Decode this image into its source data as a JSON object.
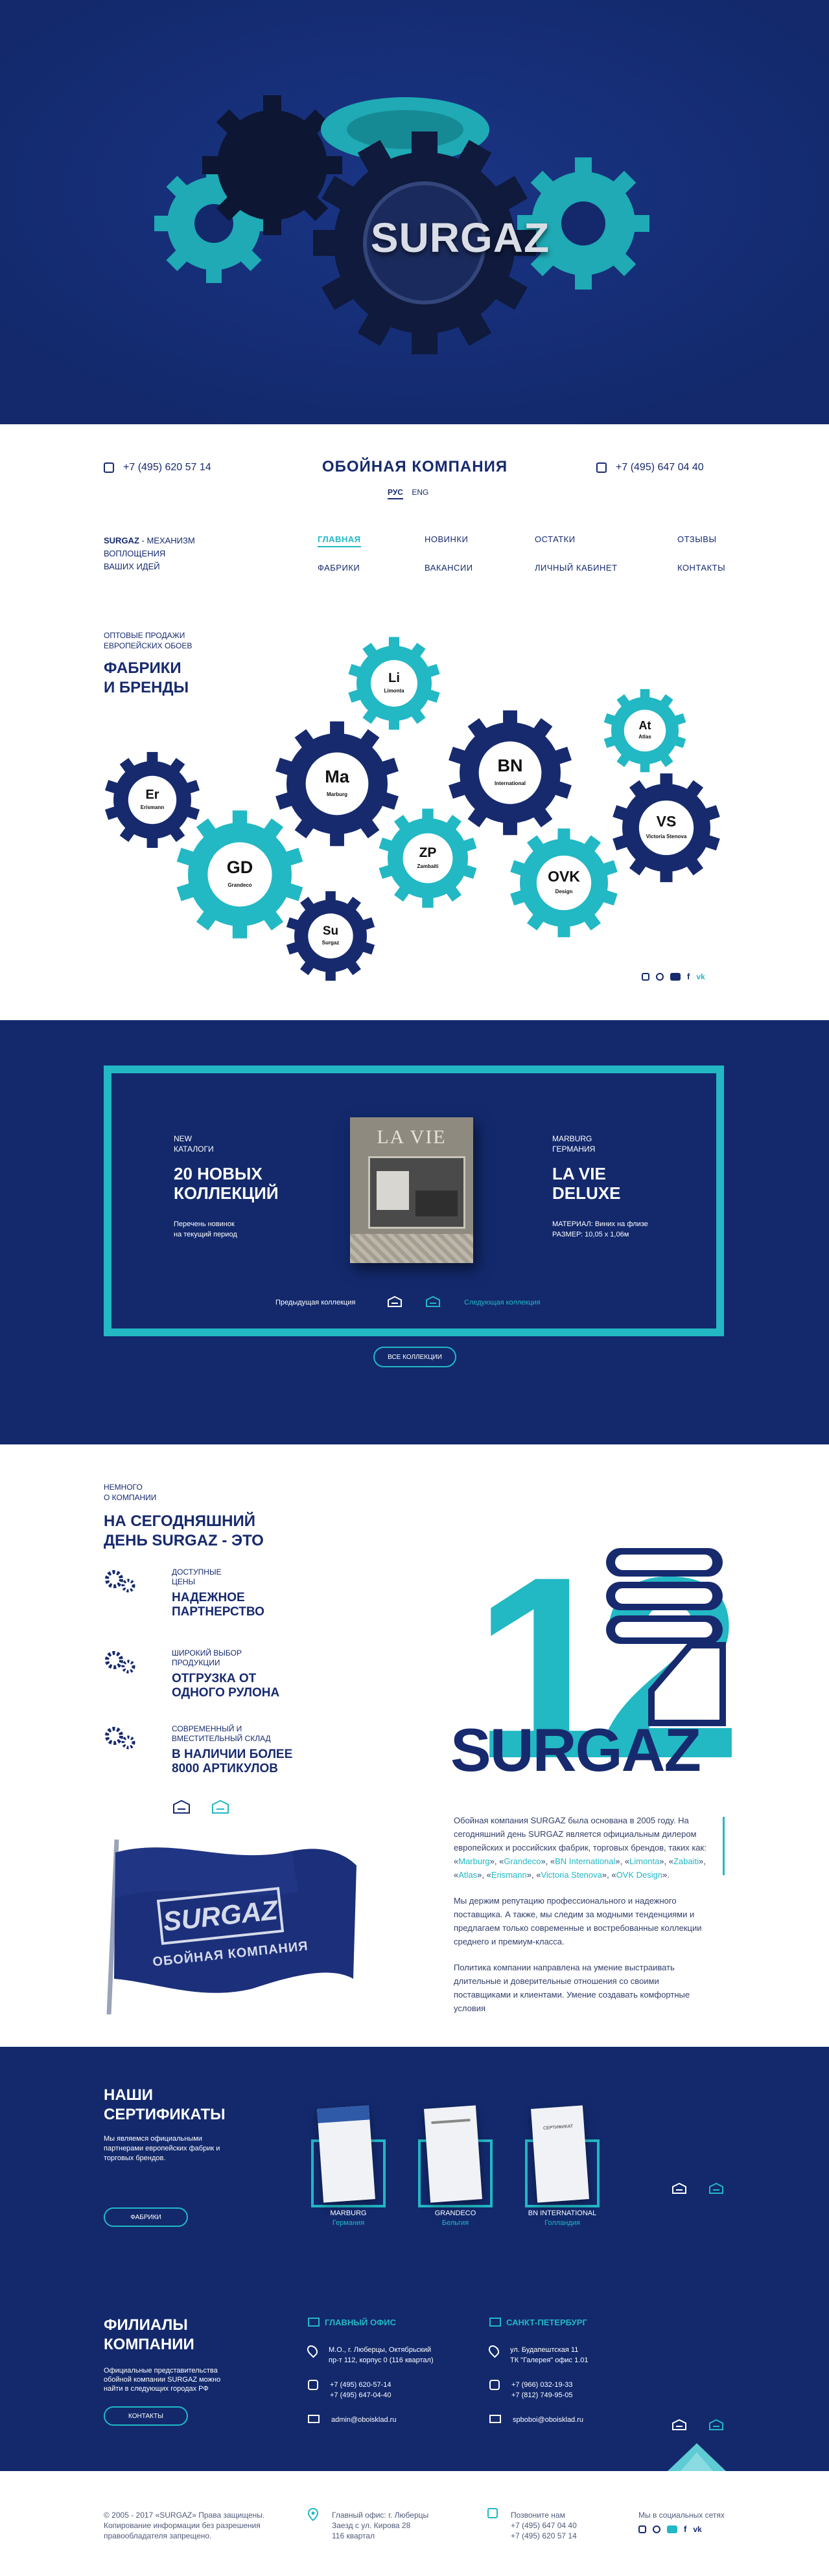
{
  "hero": {
    "logo_text": "SURGAZ"
  },
  "header": {
    "phone_left": "+7 (495) 620 57 14",
    "phone_right": "+7 (495) 647 04 40",
    "company": "ОБОЙНАЯ КОМПАНИЯ",
    "lang_ru": "РУС",
    "lang_en": "ENG",
    "tagline_bold": "SURGAZ",
    "tagline_rest": " - МЕХАНИЗМ",
    "tagline_2": "ВОПЛОЩЕНИЯ",
    "tagline_3": "ВАШИХ ИДЕЙ",
    "nav": {
      "home": "Главная",
      "news": "Новинки",
      "stock": "Остатки",
      "reviews": "Отзывы",
      "factories": "Фабрики",
      "jobs": "Вакансии",
      "cabinet": "Личный кабинет",
      "contacts": "Контакты"
    }
  },
  "brands": {
    "subtitle_1": "ОПТОВЫЕ ПРОДАЖИ",
    "subtitle_2": "ЕВРОПЕЙСКИХ ОБОЕВ",
    "title_1": "ФАБРИКИ",
    "title_2": "И БРЕНДЫ",
    "items": [
      {
        "abbr": "Li",
        "name": "Limonta"
      },
      {
        "abbr": "At",
        "name": "Atlas"
      },
      {
        "abbr": "BN",
        "name": "International"
      },
      {
        "abbr": "Ma",
        "name": "Marburg"
      },
      {
        "abbr": "Er",
        "name": "Erismann"
      },
      {
        "abbr": "VS",
        "name": "Victoria Stenova"
      },
      {
        "abbr": "GD",
        "name": "Grandeco"
      },
      {
        "abbr": "ZP",
        "name": "Zambaiti"
      },
      {
        "abbr": "OVK",
        "name": "Design"
      },
      {
        "abbr": "Su",
        "name": "Surgaz"
      }
    ],
    "social": [
      "instagram-icon",
      "odnoklassniki-icon",
      "youtube-icon",
      "facebook-icon",
      "vk-icon"
    ]
  },
  "collections": {
    "kicker_1": "NEW",
    "kicker_2": "КАТАЛОГИ",
    "title_1": "20 НОВЫХ",
    "title_2": "КОЛЛЕКЦИЙ",
    "desc_1": "Перечень новинок",
    "desc_2": "на текущий период",
    "book_title": "LA VIE",
    "brand_1": "MARBURG",
    "brand_2": "ГЕРМАНИЯ",
    "name_1": "LA VIE",
    "name_2": "DELUXE",
    "material": "МАТЕРИАЛ: Виниx на флизе",
    "size": "РАЗМЕР: 10,05 x 1,06м",
    "prev": "Предыдущая коллекция",
    "next": "Следующая коллекция",
    "all": "ВСЕ КОЛЛЕКЦИИ"
  },
  "about": {
    "kicker_1": "НЕМНОГО",
    "kicker_2": "О КОМПАНИИ",
    "title_1": "НА СЕГОДНЯШНИЙ",
    "title_2": "ДЕНЬ SURGAZ - ЭТО",
    "features": [
      {
        "small_1": "ДОСТУПНЫЕ",
        "small_2": "ЦЕНЫ",
        "big_1": "НАДЕЖНОЕ",
        "big_2": "ПАРТНЕРСТВО"
      },
      {
        "small_1": "ШИРОКИЙ ВЫБОР",
        "small_2": "ПРОДУКЦИИ",
        "big_1": "ОТГРУЗКА ОТ",
        "big_2": "ОДНОГО РУЛОНА"
      },
      {
        "small_1": "СОВРЕМЕННЫЙ И",
        "small_2": "ВМЕСТИТЕЛЬНЫЙ СКЛАД",
        "big_1": "В НАЛИЧИИ БОЛЕЕ",
        "big_2": "8000 АРТИКУЛОВ"
      }
    ],
    "years": "12",
    "brand": "SURGAZ",
    "flag_brand": "SURGAZ",
    "flag_sub": "ОБОЙНАЯ КОМПАНИЯ",
    "p1_a": "Обойная компания SURGAZ была основана в 2005 году. На сегодняшний день SURGAZ является официальным дилером европейских и российских фабрик, торговых брендов, таких как: «",
    "p1_links": [
      "Marburg",
      "Grandeco",
      "BN International",
      "Limonta",
      "Zabaiti",
      "Atlas",
      "Erismann",
      "Victoria Stenova",
      "OVK Design"
    ],
    "p2": "Мы держим репутацию профессионального и надежного поставщика. А также, мы следим за модными тенденциями и предлагаем только современные и востребованные коллекции среднего и премиум-класса.",
    "p3": "Политика компании направлена на умение выстраивать длительные и доверительные отношения со своими поставщиками и клиентами. Умение создавать комфортные условия"
  },
  "certs": {
    "title_1": "НАШИ",
    "title_2": "СЕРТИФИКАТЫ",
    "desc": "Мы являемся официальными партнерами европейских фабрик и торговых брендов.",
    "button": "ФАБРИКИ",
    "items": [
      {
        "name": "MARBURG",
        "country": "Германия"
      },
      {
        "name": "GRANDECO",
        "country": "Бельгия"
      },
      {
        "name": "BN INTERNATIONAL",
        "country": "Голландия"
      }
    ],
    "cert_word": "СЕРТИФИКАТ",
    "branches_title_1": "ФИЛИАЛЫ",
    "branches_title_2": "КОМПАНИИ",
    "branches_desc": "Официальные представительства обойной компании SURGAZ можно найти в следующих городах РФ",
    "branches_button": "КОНТАКТЫ",
    "office_title": "ГЛАВНЫЙ ОФИС",
    "office_addr_1": "М.О., г. Люберцы, Октябрьский",
    "office_addr_2": "пр-т 112, корпус 0 (116 квартал)",
    "office_phone_1": "+7 (495) 620-57-14",
    "office_phone_2": "+7 (495) 647-04-40",
    "office_email": "admin@oboisklad.ru",
    "spb_title": "САНКТ-ПЕТЕРБУРГ",
    "spb_addr_1": "ул. Будапештская 11",
    "spb_addr_2": "ТК \"Галерея\" офис 1.01",
    "spb_phone_1": "+7 (966) 032-19-33",
    "spb_phone_2": "+7 (812) 749-95-05",
    "spb_email": "spboboi@oboisklad.ru"
  },
  "footer": {
    "copy_1": "© 2005 - 2017 «SURGAZ» Права защищены.",
    "copy_2": "Копирование информации без разрешения",
    "copy_3": "правообладателя запрещено.",
    "addr_1": "Главный офис: г. Люберцы",
    "addr_2": "Заезд с ул. Кирова 28",
    "addr_3": "116 квартал",
    "call": "Позвоните нам",
    "phone_1": "+7 (495) 647 04 40",
    "phone_2": "+7 (495) 620 57 14",
    "social_title": "Мы в социальных сетях"
  }
}
